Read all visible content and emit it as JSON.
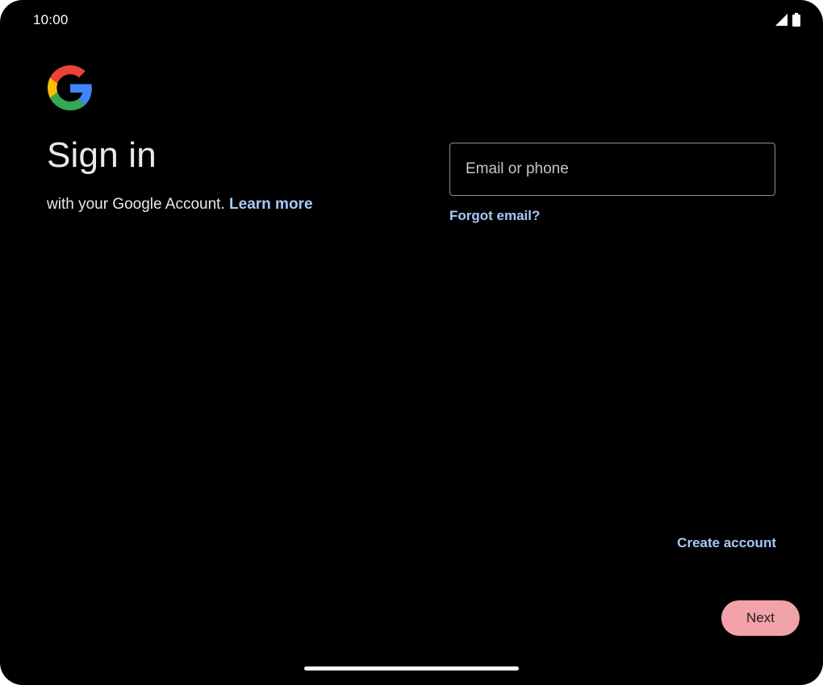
{
  "status_bar": {
    "time": "10:00",
    "icons": [
      "signal-icon",
      "battery-icon"
    ]
  },
  "brand": {
    "logo": "google-logo",
    "colors": {
      "blue": "#4285F4",
      "red": "#EA4335",
      "yellow": "#FBBC05",
      "green": "#34A853"
    }
  },
  "signin": {
    "title": "Sign in",
    "subtitle": "with your Google Account.",
    "learn_more": "Learn more"
  },
  "form": {
    "email_placeholder": "Email or phone",
    "email_value": "",
    "forgot_email": "Forgot email?"
  },
  "actions": {
    "create_account": "Create account",
    "next": "Next"
  },
  "theme": {
    "background": "#000000",
    "link": "#a8c7fa",
    "primary_button": "#f2a2a9"
  }
}
